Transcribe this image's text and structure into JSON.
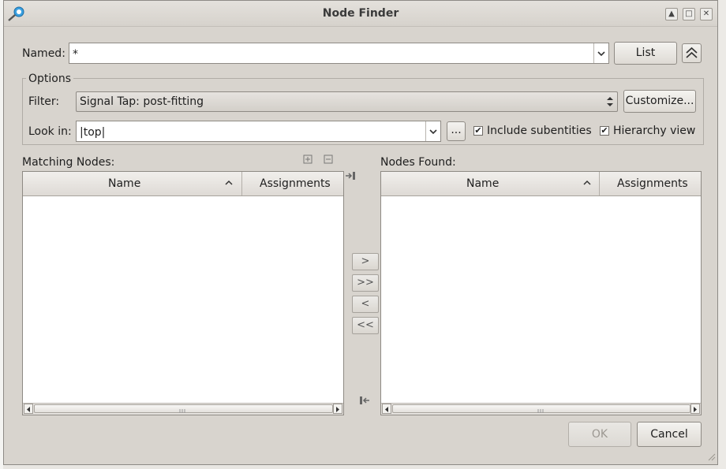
{
  "window": {
    "title": "Node Finder"
  },
  "named": {
    "label": "Named:",
    "value": "*",
    "list_button": "List"
  },
  "options": {
    "group_label": "Options",
    "filter_label": "Filter:",
    "filter_value": "Signal Tap: post-fitting",
    "customize_button": "Customize...",
    "lookin_label": "Look in:",
    "lookin_value": "|top|",
    "browse_button": "...",
    "include_subentities": {
      "label": "Include subentities",
      "checked": true
    },
    "hierarchy_view": {
      "label": "Hierarchy view",
      "checked": true
    }
  },
  "matching_nodes": {
    "label": "Matching Nodes:",
    "columns": [
      "Name",
      "Assignments"
    ],
    "rows": []
  },
  "nodes_found": {
    "label": "Nodes Found:",
    "columns": [
      "Name",
      "Assignments"
    ],
    "rows": []
  },
  "transfer_buttons": {
    "add": ">",
    "add_all": ">>",
    "remove": "<",
    "remove_all": "<<"
  },
  "footer": {
    "ok": "OK",
    "cancel": "Cancel"
  },
  "icons": {
    "app": "node-finder-app-icon",
    "expand_all": "expand-all-icon",
    "collapse_all": "collapse-all-icon",
    "copy_to_right": "copy-selected-icon",
    "copy_back": "copy-back-icon",
    "collapse_options": "double-chevron-up-icon"
  },
  "colors": {
    "window_bg": "#d8d4ce",
    "field_bg": "#ffffff",
    "border": "#8e8a84"
  }
}
